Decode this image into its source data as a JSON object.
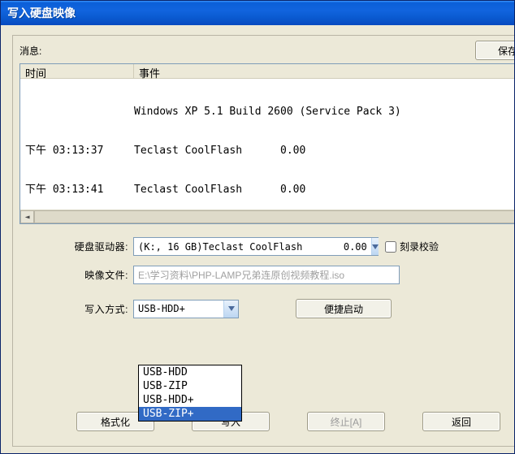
{
  "window": {
    "title": "写入硬盘映像"
  },
  "header": {
    "message_label": "消息:",
    "save_button": "保存"
  },
  "log": {
    "columns": {
      "time": "时间",
      "event": "事件"
    },
    "rows": [
      {
        "time": "",
        "event": "Windows XP 5.1 Build 2600 (Service Pack 3)"
      },
      {
        "time": "下午 03:13:37",
        "event": "Teclast CoolFlash      0.00"
      },
      {
        "time": "下午 03:13:41",
        "event": "Teclast CoolFlash      0.00"
      }
    ]
  },
  "form": {
    "drive_label": "硬盘驱动器:",
    "drive_value": "(K:, 16 GB)Teclast CoolFlash       0.00",
    "verify_label": "刻录校验",
    "verify_checked": false,
    "image_label": "映像文件:",
    "image_value": "E:\\学习资料\\PHP-LAMP兄弟连原创视频教程.iso",
    "method_label": "写入方式:",
    "method_value": "USB-HDD+",
    "method_options": [
      "USB-HDD",
      "USB-ZIP",
      "USB-HDD+",
      "USB-ZIP+"
    ],
    "method_highlighted": "USB-ZIP+",
    "quick_boot_button": "便捷启动"
  },
  "buttons": {
    "format": "格式化",
    "write": "写入",
    "abort": "终止[A]",
    "return": "返回"
  },
  "colors": {
    "titlebar_start": "#3a95ff",
    "titlebar_end": "#084abf",
    "panel_bg": "#ece9d8",
    "selection": "#316ac5"
  }
}
